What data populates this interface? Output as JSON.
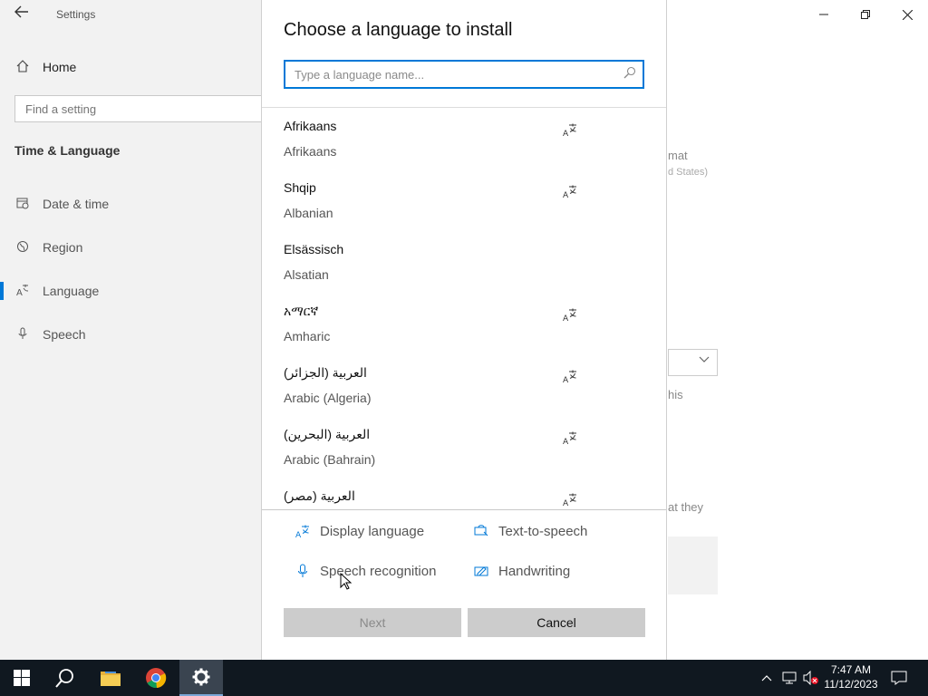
{
  "settings": {
    "window_title": "Settings",
    "home_label": "Home",
    "search_placeholder": "Find a setting",
    "section_heading": "Time & Language",
    "nav_items": [
      {
        "label": "Date & time"
      },
      {
        "label": "Region"
      },
      {
        "label": "Language"
      },
      {
        "label": "Speech"
      }
    ],
    "background_fragments": [
      "mat",
      "d States)",
      "his",
      "at they"
    ]
  },
  "dialog": {
    "title": "Choose a language to install",
    "search_placeholder": "Type a language name...",
    "languages": [
      {
        "native": "Afrikaans",
        "english": "Afrikaans",
        "has_display_language": true
      },
      {
        "native": "Shqip",
        "english": "Albanian",
        "has_display_language": true
      },
      {
        "native": "Elsässisch",
        "english": "Alsatian",
        "has_display_language": false
      },
      {
        "native": "አማርኛ",
        "english": "Amharic",
        "has_display_language": true
      },
      {
        "native": "العربية (الجزائر)",
        "english": "Arabic (Algeria)",
        "has_display_language": true
      },
      {
        "native": "العربية (البحرين)",
        "english": "Arabic (Bahrain)",
        "has_display_language": true
      },
      {
        "native": "العربية (مصر)",
        "english": "",
        "has_display_language": true
      }
    ],
    "legend": {
      "display_language": "Display language",
      "text_to_speech": "Text-to-speech",
      "speech_recognition": "Speech recognition",
      "handwriting": "Handwriting"
    },
    "next_label": "Next",
    "cancel_label": "Cancel",
    "accent_color": "#0078d7"
  },
  "taskbar": {
    "time": "7:47 AM",
    "date": "11/12/2023"
  }
}
